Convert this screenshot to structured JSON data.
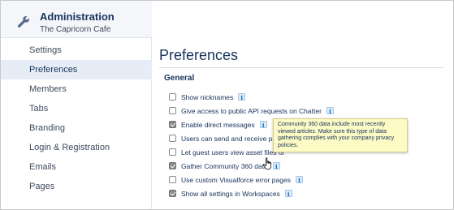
{
  "app": {
    "title": "Administration",
    "subtitle": "The Capricorn Cafe",
    "icon": "wrench-icon"
  },
  "sidebar": {
    "items": [
      {
        "label": "Settings",
        "active": false
      },
      {
        "label": "Preferences",
        "active": true
      },
      {
        "label": "Members",
        "active": false
      },
      {
        "label": "Tabs",
        "active": false
      },
      {
        "label": "Branding",
        "active": false
      },
      {
        "label": "Login & Registration",
        "active": false
      },
      {
        "label": "Emails",
        "active": false
      },
      {
        "label": "Pages",
        "active": false
      }
    ]
  },
  "main": {
    "page_title": "Preferences",
    "section_title": "General",
    "preferences": [
      {
        "label": "Show nicknames",
        "checked": false,
        "info": "i"
      },
      {
        "label": "Give access to public API requests on Chatter",
        "checked": false,
        "info": "i"
      },
      {
        "label": "Enable direct messages",
        "checked": true,
        "info": "i"
      },
      {
        "label": "Users can send and receive privat",
        "checked": false
      },
      {
        "label": "Let guest users view asset files or",
        "checked": false
      },
      {
        "label": "Gather Community 360 data",
        "checked": true,
        "info": "i"
      },
      {
        "label": "Use custom Visualforce error pages",
        "checked": false,
        "info": "i"
      },
      {
        "label": "Show all settings in Workspaces",
        "checked": true,
        "info": "i"
      }
    ],
    "tooltip": "Community 360 data include most recently viewed articles. Make sure this type of data gathering complies with your company privacy policies."
  },
  "colors": {
    "accent": "#0070d2",
    "text": "#16325c",
    "active_nav_bg": "#e6edf6",
    "tooltip_bg": "#fdfbc5"
  }
}
